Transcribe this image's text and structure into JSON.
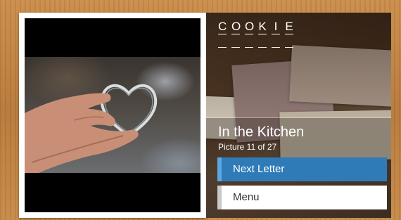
{
  "photo": {
    "subject": "hand-holding-heart-cookie-cutter"
  },
  "word": {
    "letters": [
      "C",
      "O",
      "O",
      "K",
      "I",
      "E"
    ]
  },
  "info": {
    "title": "In the Kitchen",
    "subtitle": "Picture 11 of 27"
  },
  "buttons": {
    "next_letter": "Next Letter",
    "menu": "Menu"
  },
  "colors": {
    "accent": "#2f7bb8",
    "accent_edge": "#5aa7e3",
    "menu_bg": "#ffffff"
  }
}
